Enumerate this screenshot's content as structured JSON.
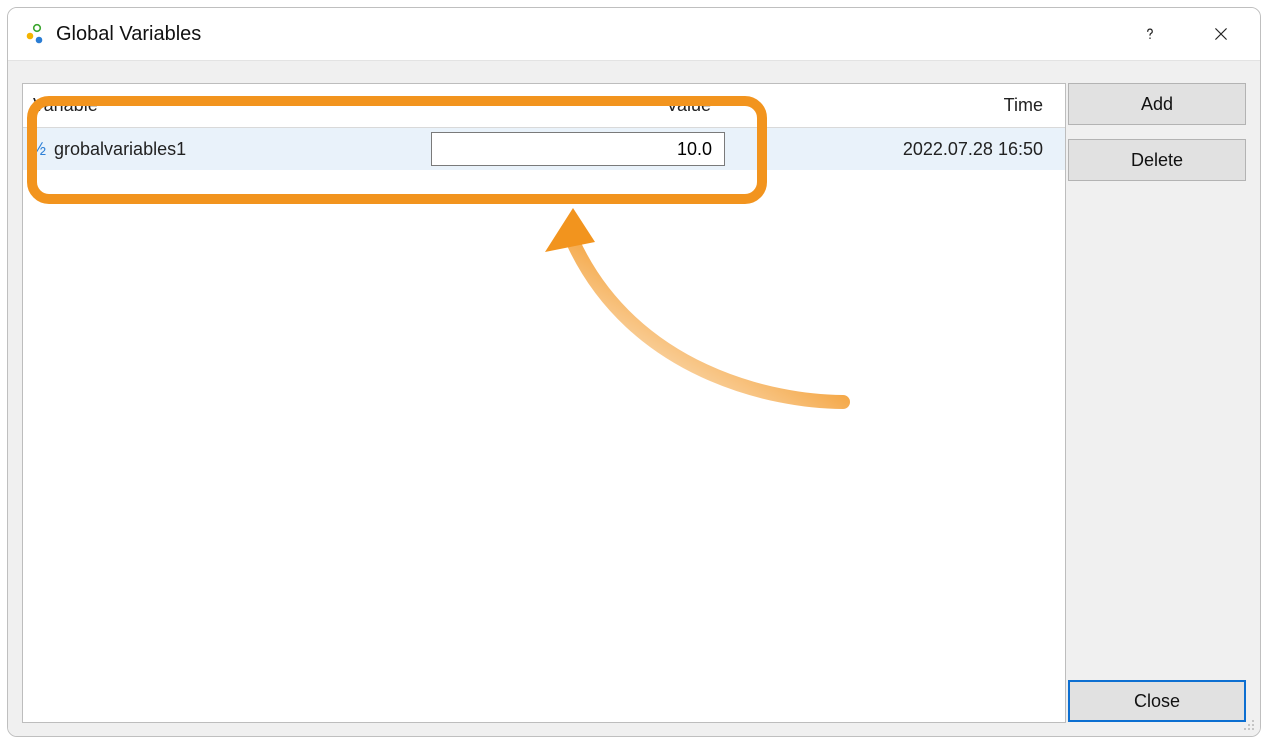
{
  "window": {
    "title": "Global Variables"
  },
  "columns": {
    "variable": "Variable",
    "value": "Value",
    "time": "Time"
  },
  "rows": [
    {
      "name": "grobalvariables1",
      "value": "10.0",
      "time": "2022.07.28 16:50"
    }
  ],
  "buttons": {
    "add": "Add",
    "delete": "Delete",
    "close": "Close"
  }
}
